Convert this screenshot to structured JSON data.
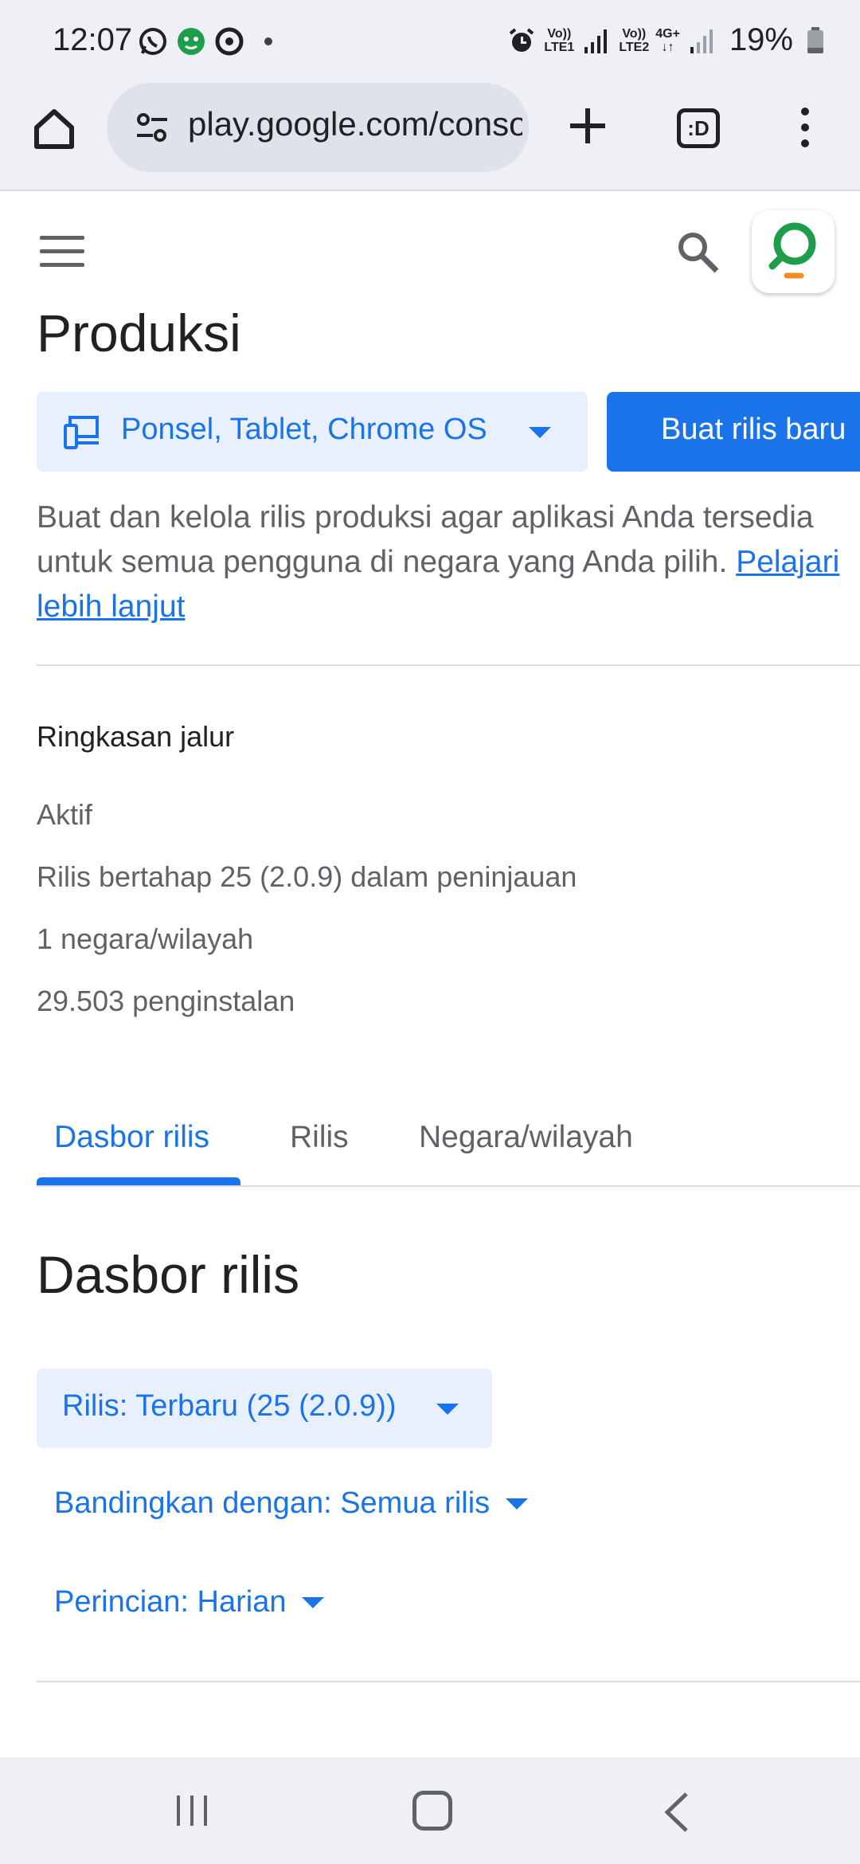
{
  "status_bar": {
    "time": "12:07",
    "signal_1_top": "Vo))",
    "signal_1_bottom": "LTE1",
    "signal_2_top": "Vo))",
    "signal_2_bottom": "LTE2",
    "network_top": "4G+",
    "network_bottom": "↓↑",
    "battery": "19%"
  },
  "browser": {
    "url": "play.google.com/console",
    "tabs_label": ":D"
  },
  "page": {
    "title": "Produksi",
    "device_select_label": "Ponsel, Tablet, Chrome OS",
    "create_button_label": "Buat rilis baru",
    "description": "Buat dan kelola rilis produksi agar aplikasi Anda tersedia untuk semua pengguna di negara yang Anda pilih.",
    "learn_more": "Pelajari lebih lanjut"
  },
  "summary": {
    "title": "Ringkasan jalur",
    "lines": [
      "Aktif",
      "Rilis bertahap 25 (2.0.9) dalam peninjauan",
      "1 negara/wilayah",
      "29.503 penginstalan"
    ]
  },
  "tabs": [
    {
      "label": "Dasbor rilis",
      "active": true
    },
    {
      "label": "Rilis",
      "active": false
    },
    {
      "label": "Negara/wilayah",
      "active": false
    }
  ],
  "dashboard": {
    "title": "Dasbor rilis",
    "release_select": "Rilis: Terbaru (25 (2.0.9))",
    "compare": "Bandingkan dengan: Semua rilis",
    "breakdown": "Perincian: Harian"
  },
  "colors": {
    "accent": "#1a73e8",
    "accent_light": "#e8f0fe",
    "text_secondary": "#5f6368"
  }
}
